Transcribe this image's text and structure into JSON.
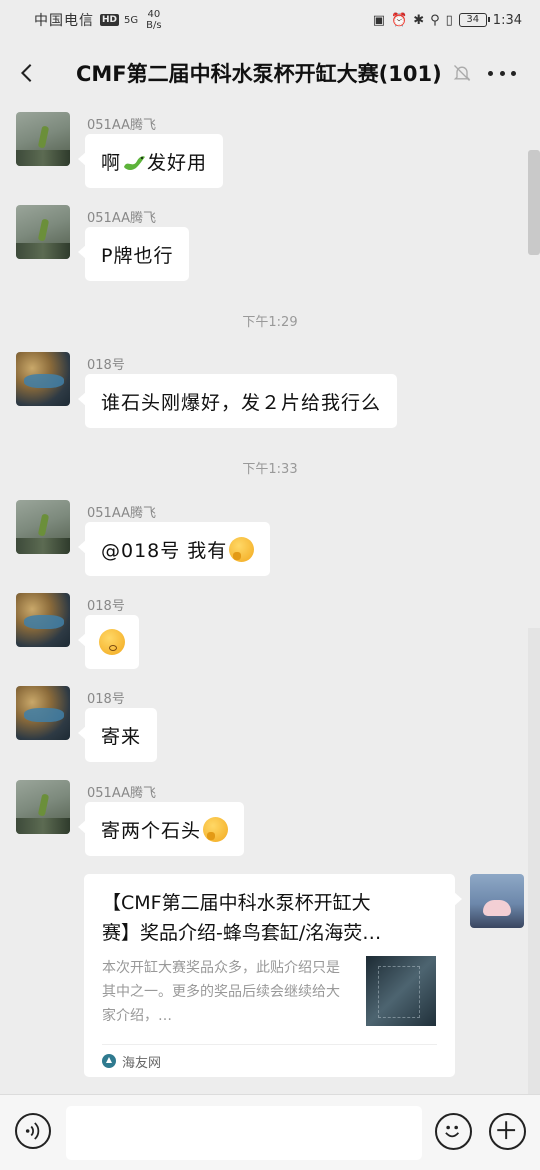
{
  "status_bar": {
    "carrier": "中国电信",
    "hd": "HD",
    "signal": "5G",
    "speed_value": "40",
    "speed_unit": "B/s",
    "battery": "34",
    "time": "1:34"
  },
  "header": {
    "title": "CMF第二届中科水泵杯开缸大赛(101)"
  },
  "messages": [
    {
      "sender": "051AA腾飞",
      "text_before": "啊",
      "text_after": "发好用"
    },
    {
      "sender": "051AA腾飞",
      "text": "P牌也行"
    },
    {
      "time": "下午1:29"
    },
    {
      "sender": "018号",
      "text": "谁石头刚爆好，发２片给我行么"
    },
    {
      "time": "下午1:33"
    },
    {
      "sender": "051AA腾飞",
      "text": "@018号 我有"
    },
    {
      "sender": "018号"
    },
    {
      "sender": "018号",
      "text": "寄来"
    },
    {
      "sender": "051AA腾飞",
      "text": "寄两个石头"
    }
  ],
  "link_card": {
    "title_line1": "【CMF第二届中科水泵杯开缸大",
    "title_line2": "赛】奖品介绍-蜂鸟套缸/洺海荧…",
    "description": "本次开缸大赛奖品众多，此贴介绍只是其中之一。更多的奖品后续会继续给大家介绍，…",
    "source": "海友网"
  },
  "icons": [
    "back-icon",
    "mute-icon",
    "more-icon",
    "voice-icon",
    "emoji-icon",
    "plus-icon"
  ]
}
